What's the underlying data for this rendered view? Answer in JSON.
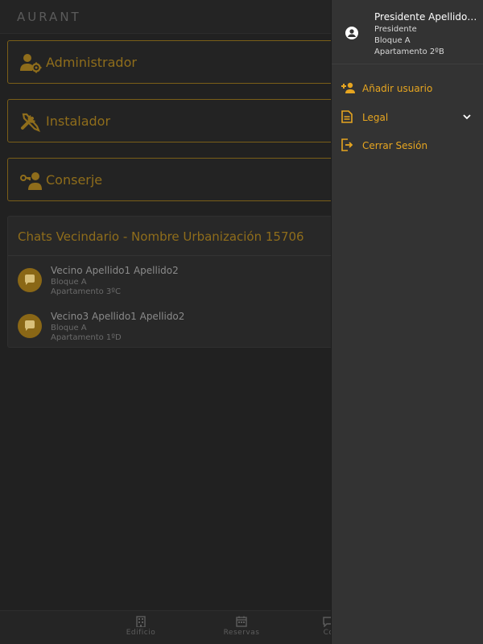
{
  "app": {
    "logo_text": "AURANT"
  },
  "roles": [
    {
      "label": "Administrador"
    },
    {
      "label": "Instalador"
    },
    {
      "label": "Conserje"
    }
  ],
  "chats": {
    "title": "Chats Vecindario - Nombre Urbanización 15706",
    "items": [
      {
        "name": "Vecino Apellido1 Apellido2",
        "block": "Bloque A",
        "apartment": "Apartamento 3ºC"
      },
      {
        "name": "Vecino3 Apellido1 Apellido2",
        "block": "Bloque A",
        "apartment": "Apartamento 1ºD"
      }
    ]
  },
  "bottom_nav": {
    "items": [
      {
        "label": "Edificio",
        "icon": "building-icon"
      },
      {
        "label": "Reservas",
        "icon": "calendar-icon"
      },
      {
        "label": "Co",
        "icon": "chat-icon"
      }
    ]
  },
  "drawer": {
    "user": {
      "name": "Presidente Apellido1...",
      "role": "Presidente",
      "block": "Bloque A",
      "apartment": "Apartamento 2ºB"
    },
    "menu": [
      {
        "label": "Añadir usuario",
        "icon": "person-add-icon"
      },
      {
        "label": "Legal",
        "icon": "document-icon"
      },
      {
        "label": "Cerrar Sesión",
        "icon": "logout-icon"
      }
    ]
  },
  "colors": {
    "accent": "#e6a520",
    "accent_dim": "#8f6d1b",
    "background": "#212121",
    "drawer": "#333333"
  }
}
